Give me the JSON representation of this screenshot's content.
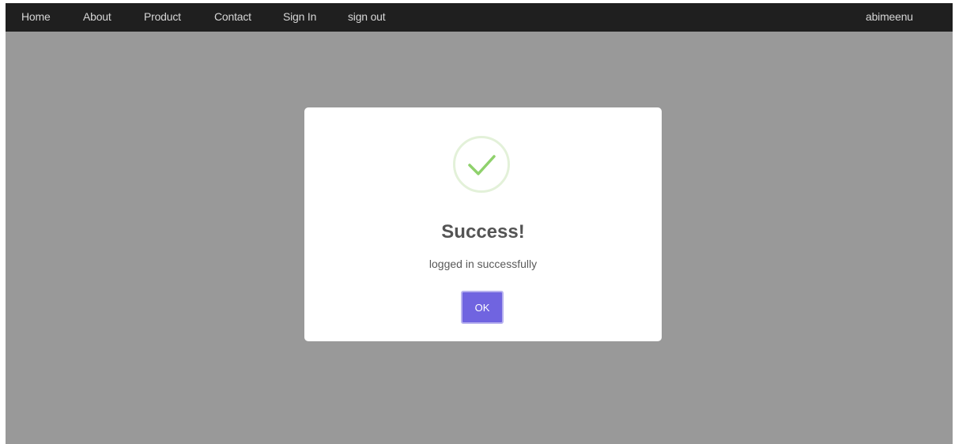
{
  "navbar": {
    "links": [
      "Home",
      "About",
      "Product",
      "Contact",
      "Sign In",
      "sign out"
    ],
    "username": "abimeenu"
  },
  "dialog": {
    "icon": "checkmark-icon",
    "title": "Success!",
    "message": "logged in successfully",
    "ok_label": "OK"
  },
  "colors": {
    "navbar_bg": "#1f1f1f",
    "overlay": "#999999",
    "success_green": "#8fd16c",
    "button_purple": "#7064e0"
  }
}
